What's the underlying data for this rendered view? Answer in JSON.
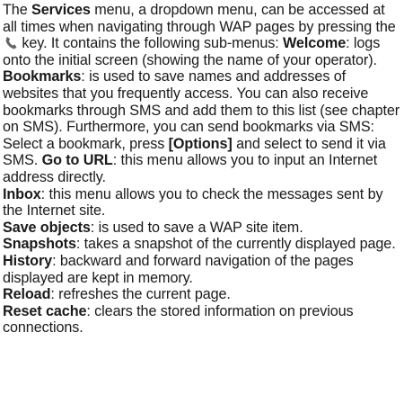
{
  "intro": {
    "t1": "The ",
    "services": "Services",
    "t2": " menu, a dropdown menu, can be accessed at all times when navigating through WAP pages by pressing the ",
    "key_icon": "phone-handset-key-icon",
    "t3": " key. It contains the following sub-menus: ",
    "welcome": "Welcome",
    "t4": ": logs onto the initial screen (showing the name of your operator). ",
    "bookmarks": "Bookmarks",
    "t5": ": is used to save names and addresses of websites that you frequently access. You can also receive bookmarks through SMS and add them to this list (see chapter on SMS). Furthermore, you can send bookmarks via SMS: Select a bookmark, press ",
    "options": "[Options]",
    "t6": " and select to send it via SMS. ",
    "go_to_url": "Go to URL",
    "t7": ": this menu allows you to input an Internet address directly."
  },
  "items": [
    {
      "term": "Inbox",
      "desc": ": this menu allows you to check the messages sent by the Internet site."
    },
    {
      "term": "Save objects",
      "desc": ": is used to save a WAP site item."
    },
    {
      "term": "Snapshots",
      "desc": ": takes a snapshot of the currently displayed page."
    },
    {
      "term": "History",
      "desc": ": backward and forward navigation of the pages displayed are kept in memory."
    },
    {
      "term": "Reload",
      "desc": ": refreshes the current page."
    },
    {
      "term": "Reset cache",
      "desc": ": clears the stored information on previous connections."
    }
  ]
}
